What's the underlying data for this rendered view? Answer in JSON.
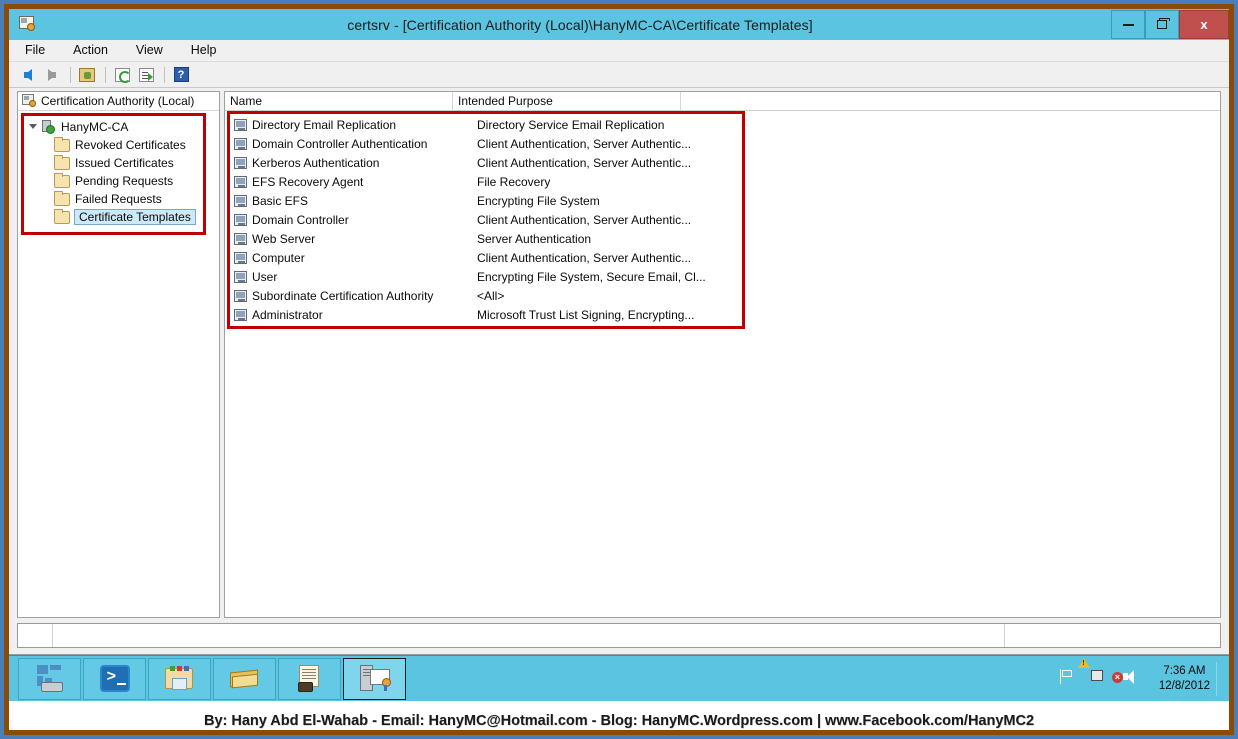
{
  "window": {
    "title": "certsrv - [Certification Authority (Local)\\HanyMC-CA\\Certificate Templates]",
    "icon": "certificate-authority-icon",
    "buttons": {
      "minimize": "minimize-icon",
      "maximize": "maximize-icon",
      "close": "x"
    }
  },
  "menubar": {
    "items": [
      {
        "label": "File"
      },
      {
        "label": "Action"
      },
      {
        "label": "View"
      },
      {
        "label": "Help"
      }
    ]
  },
  "toolbar": {
    "buttons": [
      {
        "name": "back-icon"
      },
      {
        "name": "forward-icon"
      },
      {
        "name": "up-one-level-icon"
      },
      {
        "name": "refresh-icon"
      },
      {
        "name": "export-list-icon"
      },
      {
        "name": "help-icon",
        "label": "?"
      }
    ]
  },
  "tree": {
    "root_label": "Certification Authority (Local)",
    "nodes": [
      {
        "label": "HanyMC-CA",
        "icon": "ca-server-icon",
        "level": 1,
        "expanded": true,
        "selected": false
      },
      {
        "label": "Revoked Certificates",
        "icon": "folder-icon",
        "level": 2,
        "selected": false
      },
      {
        "label": "Issued Certificates",
        "icon": "folder-icon",
        "level": 2,
        "selected": false
      },
      {
        "label": "Pending Requests",
        "icon": "folder-icon",
        "level": 2,
        "selected": false
      },
      {
        "label": "Failed Requests",
        "icon": "folder-icon",
        "level": 2,
        "selected": false
      },
      {
        "label": "Certificate Templates",
        "icon": "folder-icon",
        "level": 2,
        "selected": true
      }
    ]
  },
  "list": {
    "columns": [
      {
        "label": "Name"
      },
      {
        "label": "Intended Purpose"
      }
    ],
    "rows": [
      {
        "name": "Directory Email Replication",
        "purpose": "Directory Service Email Replication"
      },
      {
        "name": "Domain Controller Authentication",
        "purpose": "Client Authentication, Server Authentic..."
      },
      {
        "name": "Kerberos Authentication",
        "purpose": "Client Authentication, Server Authentic..."
      },
      {
        "name": "EFS Recovery Agent",
        "purpose": "File Recovery"
      },
      {
        "name": "Basic EFS",
        "purpose": "Encrypting File System"
      },
      {
        "name": "Domain Controller",
        "purpose": "Client Authentication, Server Authentic..."
      },
      {
        "name": "Web Server",
        "purpose": "Server Authentication"
      },
      {
        "name": "Computer",
        "purpose": "Client Authentication, Server Authentic..."
      },
      {
        "name": "User",
        "purpose": "Encrypting File System, Secure Email, Cl..."
      },
      {
        "name": "Subordinate Certification Authority",
        "purpose": "<All>"
      },
      {
        "name": "Administrator",
        "purpose": "Microsoft Trust List Signing, Encrypting..."
      }
    ]
  },
  "statusbar": {
    "segments": [
      "",
      "",
      ""
    ]
  },
  "taskbar": {
    "buttons": [
      {
        "name": "server-manager-icon",
        "active": false
      },
      {
        "name": "powershell-icon",
        "active": false
      },
      {
        "name": "file-explorer-icon",
        "active": false
      },
      {
        "name": "book-icon",
        "active": false
      },
      {
        "name": "scroll-toolbox-icon",
        "active": false
      },
      {
        "name": "certification-authority-icon",
        "active": true
      }
    ],
    "tray": {
      "icons": [
        "flag-icon",
        "network-warning-icon",
        "speaker-muted-icon"
      ],
      "time": "7:36 AM",
      "date": "12/8/2012"
    }
  },
  "footer": {
    "credit": "By: Hany Abd El-Wahab - Email: HanyMC@Hotmail.com - Blog: HanyMC.Wordpress.com | www.Facebook.com/HanyMC2"
  },
  "colors": {
    "outer_border": "#4a7ebb",
    "window_frame": "#8a4b06",
    "titlebar": "#5bc4e0",
    "close_button": "#c0504d",
    "highlight_box": "#c00000",
    "selection": "#cde8f7"
  }
}
